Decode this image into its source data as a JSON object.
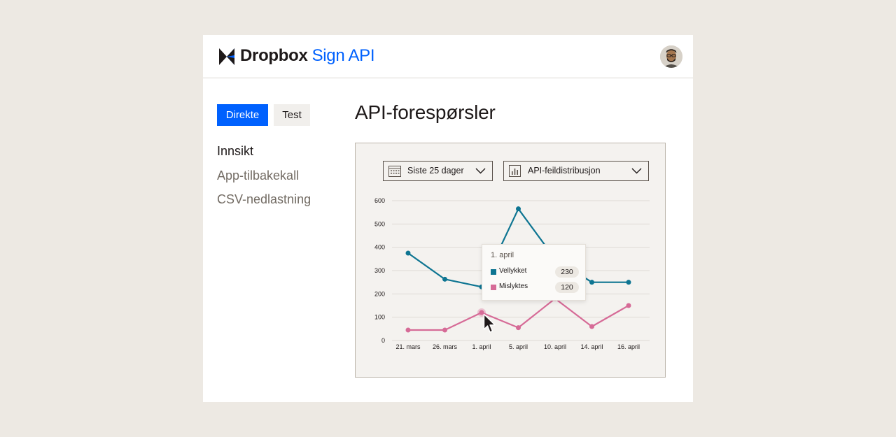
{
  "header": {
    "brand_name": "Dropbox",
    "product_name": "Sign API"
  },
  "environment_tabs": [
    {
      "label": "Direkte",
      "active": true
    },
    {
      "label": "Test",
      "active": false
    }
  ],
  "sidebar": {
    "items": [
      {
        "label": "Innsikt",
        "active": true
      },
      {
        "label": "App-tilbakekall",
        "active": false
      },
      {
        "label": "CSV-nedlastning",
        "active": false
      }
    ]
  },
  "main": {
    "title": "API-forespørsler"
  },
  "filters": {
    "date_range": {
      "value": "Siste 25 dager",
      "icon": "calendar-icon"
    },
    "metric": {
      "value": "API-feildistribusjon",
      "icon": "bar-chart-icon"
    }
  },
  "colors": {
    "accent": "#0061fe",
    "success_series": "#0e7592",
    "failed_series": "#d66b97"
  },
  "tooltip": {
    "title": "1. april",
    "rows": [
      {
        "label": "Vellykket",
        "value": "230"
      },
      {
        "label": "Mislyktes",
        "value": "120"
      }
    ]
  },
  "chart_data": {
    "type": "line",
    "title": "",
    "xlabel": "",
    "ylabel": "",
    "ylim": [
      0,
      600
    ],
    "yticks": [
      0,
      100,
      200,
      300,
      400,
      500,
      600
    ],
    "categories": [
      "21. mars",
      "26. mars",
      "1. april",
      "5. april",
      "10. april",
      "14. april",
      "16. april"
    ],
    "grid": true,
    "series": [
      {
        "name": "Vellykket",
        "color": "#0e7592",
        "values": [
          375,
          263,
          230,
          565,
          350,
          250,
          250
        ]
      },
      {
        "name": "Mislyktes",
        "color": "#d66b97",
        "values": [
          45,
          45,
          120,
          55,
          180,
          60,
          150
        ]
      }
    ]
  }
}
